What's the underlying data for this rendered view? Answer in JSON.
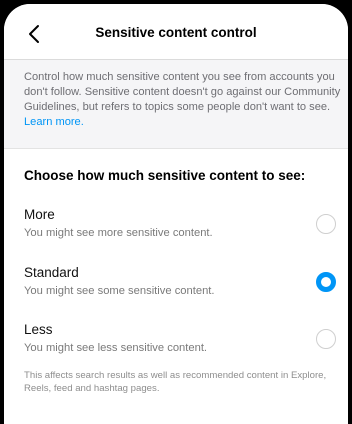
{
  "header": {
    "title": "Sensitive content control",
    "back_icon": "chevron-left-icon"
  },
  "intro": {
    "text": "Control how much sensitive content you see from accounts you don't follow. Sensitive content doesn't go against our Community Guidelines, but refers to topics some people don't want to see. ",
    "link": "Learn more."
  },
  "section": {
    "heading": "Choose how much sensitive content to see:"
  },
  "options": [
    {
      "title": "More",
      "description": "You might see more sensitive content.",
      "selected": false
    },
    {
      "title": "Standard",
      "description": "You might see some sensitive content.",
      "selected": true
    },
    {
      "title": "Less",
      "description": "You might see less sensitive content.",
      "selected": false
    }
  ],
  "footnote": "This affects search results as well as recommended content in Explore, Reels, feed and hashtag pages.",
  "colors": {
    "accent": "#0095f6",
    "intro_background": "#f5f5f7",
    "secondary_text": "#7a7a7a"
  }
}
